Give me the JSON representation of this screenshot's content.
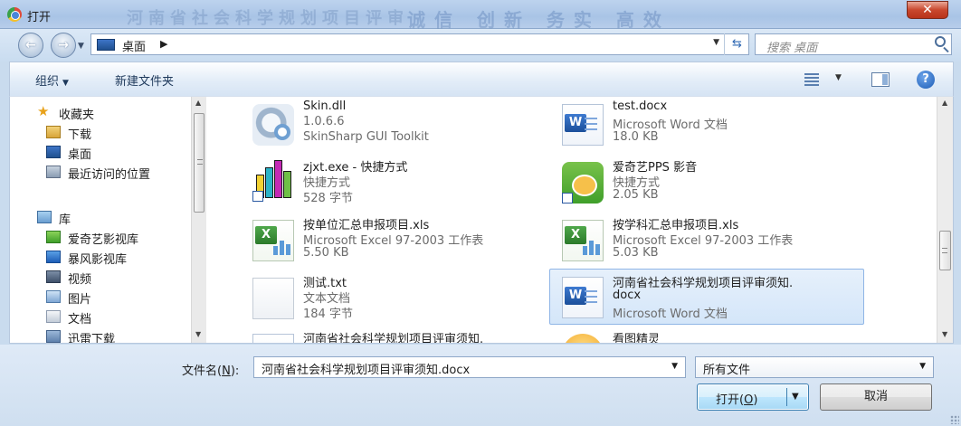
{
  "window": {
    "title": "打开",
    "close_glyph": "✕"
  },
  "background_banner": {
    "left_text": "河南省社会科学规划项目评审",
    "right_text": "诚信 创新 务实 高效"
  },
  "address": {
    "crumb": "桌面",
    "search_placeholder": "搜索 桌面"
  },
  "toolbar": {
    "organize": "组织",
    "new_folder": "新建文件夹"
  },
  "sidebar": {
    "favorites": {
      "label": "收藏夹",
      "items": [
        "下载",
        "桌面",
        "最近访问的位置"
      ]
    },
    "libraries": {
      "label": "库",
      "items": [
        "爱奇艺影视库",
        "暴风影视库",
        "视频",
        "图片",
        "文档",
        "迅雷下载"
      ]
    }
  },
  "files": [
    {
      "name": "Skin.dll",
      "line2": "1.0.6.6",
      "line3": "SkinSharp GUI Toolkit",
      "icon": "gear-icon"
    },
    {
      "name": "test.docx",
      "line2": "Microsoft Word 文档",
      "line3": "18.0 KB",
      "icon": "word-icon"
    },
    {
      "name": "zjxt.exe - 快捷方式",
      "line2": "快捷方式",
      "line3": "528 字节",
      "icon": "bar-chart-icon"
    },
    {
      "name": "爱奇艺PPS 影音",
      "line2": "快捷方式",
      "line3": "2.05 KB",
      "icon": "iqiyi-icon"
    },
    {
      "name": "按单位汇总申报项目.xls",
      "line2": "Microsoft Excel 97-2003 工作表",
      "line3": "5.50 KB",
      "icon": "excel-icon"
    },
    {
      "name": "按学科汇总申报项目.xls",
      "line2": "Microsoft Excel 97-2003 工作表",
      "line3": "5.03 KB",
      "icon": "excel-icon"
    },
    {
      "name": "测试.txt",
      "line2": "文本文档",
      "line3": "184 字节",
      "icon": "text-file-icon"
    },
    {
      "name": "河南省社会科学规划项目评审须知.",
      "line2": "docx",
      "line3": "Microsoft Word 文档",
      "icon": "word-icon",
      "selected": true
    },
    {
      "name": "河南省社会科学规划项目评审须知.",
      "icon": "word-icon"
    },
    {
      "name": "看图精灵",
      "icon": "image-viewer-icon"
    }
  ],
  "bottom": {
    "filename_label_prefix": "文件名(",
    "filename_label_key": "N",
    "filename_label_suffix": "):",
    "filename_value": "河南省社会科学规划项目评审须知.docx",
    "filetype_value": "所有文件",
    "open_prefix": "打开(",
    "open_key": "O",
    "open_suffix": ")",
    "cancel": "取消"
  },
  "colors": {
    "selection_bg": "#d4e6f9",
    "selection_border": "#8fb5e6",
    "title_bar": "#b7cdea"
  }
}
